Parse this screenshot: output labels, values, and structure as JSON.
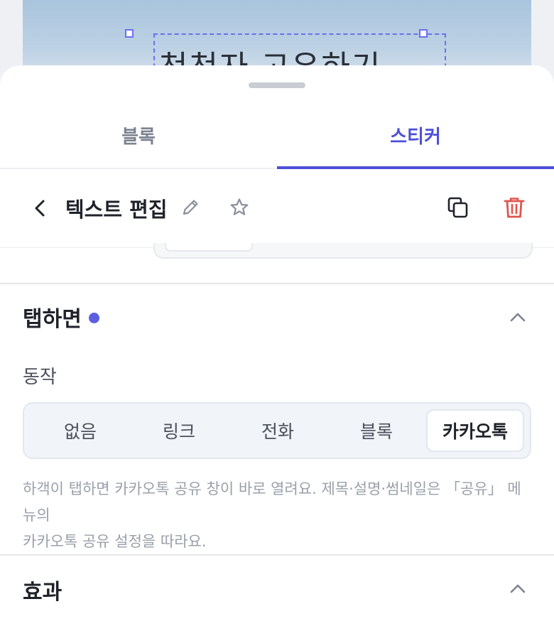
{
  "preview": {
    "text": "천천자 고유하기"
  },
  "tabs": [
    {
      "label": "블록",
      "active": false
    },
    {
      "label": "스티커",
      "active": true
    }
  ],
  "edit_bar": {
    "title": "텍스트 편집",
    "icons": [
      "back-chevron-icon",
      "pencil-icon",
      "star-icon",
      "copy-icon",
      "trash-icon"
    ]
  },
  "tap_section": {
    "title": "탭하면",
    "action_label": "동작",
    "options": [
      "없음",
      "링크",
      "전화",
      "블록",
      "카카오톡"
    ],
    "selected": "카카오톡",
    "help_line1": "하객이 탭하면 카카오톡 공유 창이 바로 열려요. 제목·설명·썸네일은 「공유」 메뉴의",
    "help_line2": "카카오톡 공유 설정을 따라요."
  },
  "effect_section": {
    "title": "효과"
  },
  "colors": {
    "accent": "#4e4fd8",
    "danger": "#e0554c",
    "muted": "#9aa0aa"
  }
}
